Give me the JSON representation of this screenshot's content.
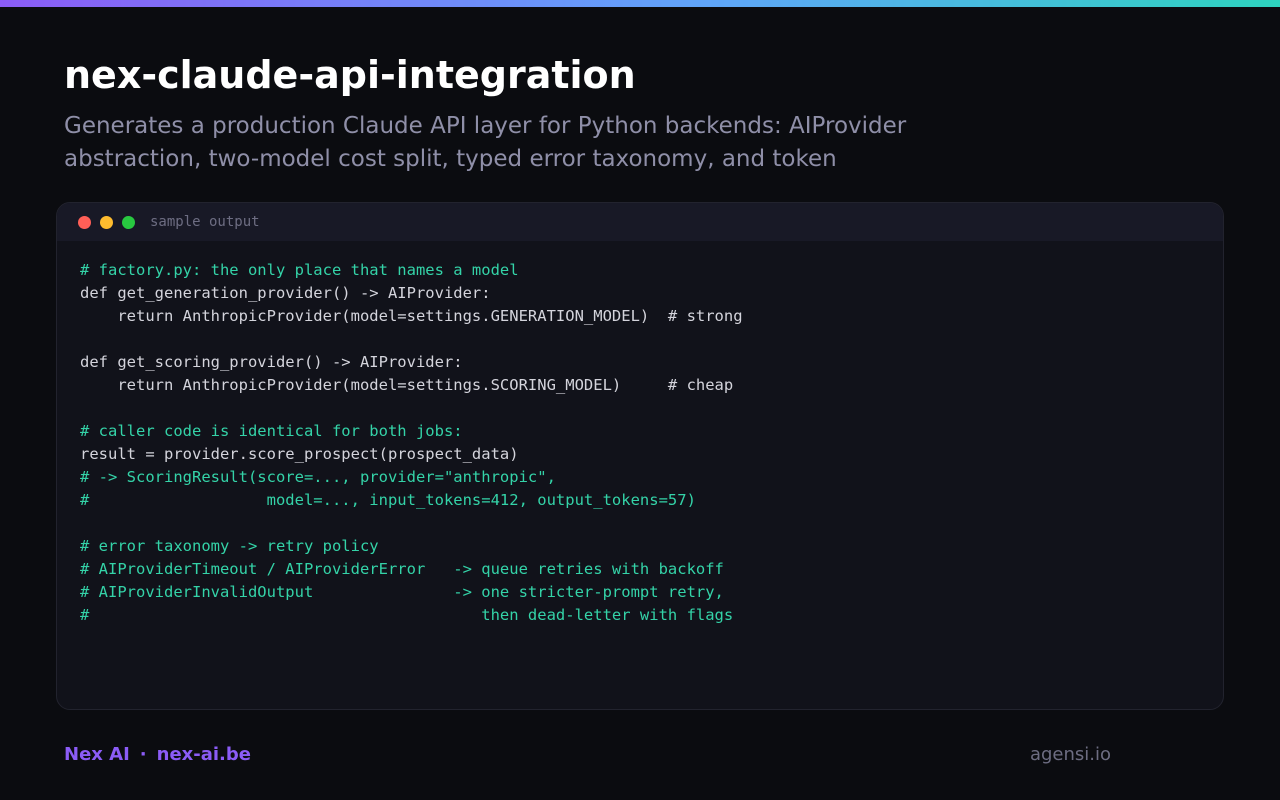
{
  "header": {
    "title": "nex-claude-api-integration",
    "subtitle": "Generates a production Claude API layer for Python backends: AIProvider abstraction, two-model cost split, typed error taxonomy, and token"
  },
  "window": {
    "label": "sample output",
    "code_lines": [
      {
        "text": "# factory.py: the only place that names a model",
        "comment": true
      },
      {
        "text": "def get_generation_provider() -> AIProvider:",
        "comment": false
      },
      {
        "text": "    return AnthropicProvider(model=settings.GENERATION_MODEL)  # strong",
        "comment": false
      },
      {
        "text": "",
        "comment": false
      },
      {
        "text": "def get_scoring_provider() -> AIProvider:",
        "comment": false
      },
      {
        "text": "    return AnthropicProvider(model=settings.SCORING_MODEL)     # cheap",
        "comment": false
      },
      {
        "text": "",
        "comment": false
      },
      {
        "text": "# caller code is identical for both jobs:",
        "comment": true
      },
      {
        "text": "result = provider.score_prospect(prospect_data)",
        "comment": false
      },
      {
        "text": "# -> ScoringResult(score=..., provider=\"anthropic\",",
        "comment": true
      },
      {
        "text": "#                   model=..., input_tokens=412, output_tokens=57)",
        "comment": true
      },
      {
        "text": "",
        "comment": false
      },
      {
        "text": "# error taxonomy -> retry policy",
        "comment": true
      },
      {
        "text": "# AIProviderTimeout / AIProviderError   -> queue retries with backoff",
        "comment": true
      },
      {
        "text": "# AIProviderInvalidOutput               -> one stricter-prompt retry,",
        "comment": true
      },
      {
        "text": "#                                          then dead-letter with flags",
        "comment": true
      }
    ]
  },
  "footer": {
    "brand": "Nex AI",
    "separator": "·",
    "domain": "nex-ai.be",
    "credit": "agensi.io"
  },
  "colors": {
    "background": "#0b0c10",
    "accent": "#8b5cf6",
    "comment": "#34d3a8",
    "code_text": "#d4d4dc",
    "muted": "#8f8fa8"
  }
}
